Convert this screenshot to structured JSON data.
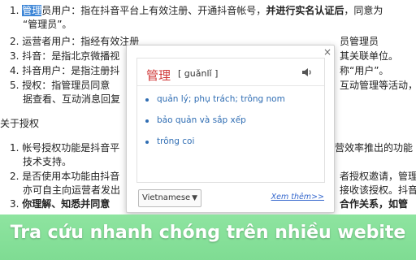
{
  "document": {
    "line1_num": "1.",
    "line1_hl": "管理",
    "line1_rest": "员用户：指在抖音平台上有效注册、开通抖音帐号，",
    "line1_bold": "并进行实名认证后",
    "line1_end": "，同意为",
    "line1b": "“管理员”。",
    "line2_num": "2.",
    "line2_left": "运营者用户：指经有效注册",
    "line2_right": "员管理员",
    "line3_num": "3.",
    "line3_left": "抖音：是指北京微播视",
    "line3_right": "其关联单位。",
    "line4_num": "4.",
    "line4_left": "抖音用户：是指注册抖",
    "line4_right": "称“用户”。",
    "line5_num": "5.",
    "line5_left": "授权：指管理员同意",
    "line5_right": "互动管理等活动，",
    "line5b": "据查看、互动消息回复",
    "section_title": "关于授权",
    "s1_num": "1.",
    "s1_left": "帐号授权功能是抖音平",
    "s1_right": "营效率推出的功能",
    "s1b": "技术支持。",
    "s2_num": "2.",
    "s2_left": "是否使用本功能由抖音",
    "s2_right": "者授权邀请，管理",
    "s2b_left": "亦可自主向运营者发出",
    "s2b_right": "接收该授权。抖音",
    "s3_num": "3.",
    "s3_left": "你理解、知悉并同意",
    "s3_right": "合作关系，如管"
  },
  "popup": {
    "close_label": "×",
    "word": "管理",
    "pronunciation": "[ guǎnlǐ ]",
    "meanings": [
      "quản lý; phụ trách; trông nom",
      "bảo quản và sắp xếp",
      "trông coi"
    ],
    "language": "Vietnamese",
    "more_label": "Xem thêm>>"
  },
  "banner": {
    "text": "Tra cứu nhanh chóng trên nhiều webite"
  }
}
